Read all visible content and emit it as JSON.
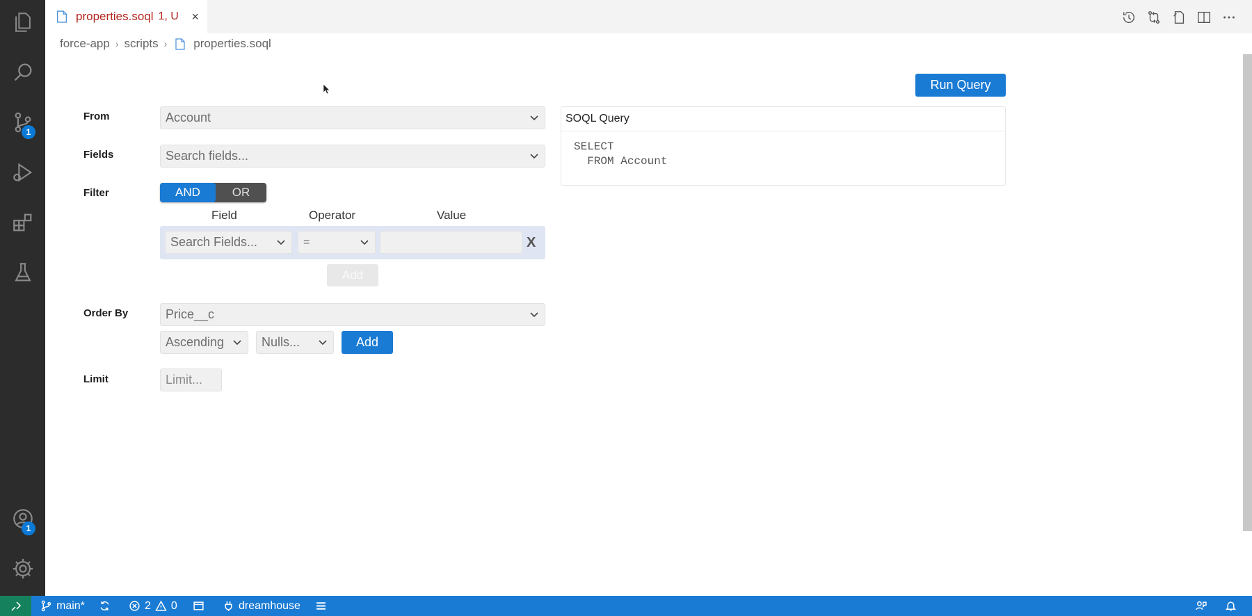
{
  "activity_bar": {
    "source_control_badge": "1",
    "accounts_badge": "1",
    "items": [
      "explorer-icon",
      "search-icon",
      "source-control-icon",
      "run-debug-icon",
      "extensions-icon",
      "testing-icon",
      "accounts-icon",
      "settings-gear-icon"
    ]
  },
  "tab": {
    "title": "properties.soql",
    "status": "1, U",
    "close": "×"
  },
  "editor_actions": [
    "history-icon",
    "compare-icon",
    "open-file-icon",
    "split-editor-icon",
    "more-actions-icon"
  ],
  "breadcrumb": {
    "items": [
      "force-app",
      "scripts",
      "properties.soql"
    ],
    "separator": "›"
  },
  "builder": {
    "run_query_label": "Run Query",
    "from": {
      "label": "From",
      "value": "Account"
    },
    "fields": {
      "label": "Fields",
      "placeholder": "Search fields..."
    },
    "filter": {
      "label": "Filter",
      "and_label": "AND",
      "or_label": "OR",
      "columns": {
        "field": "Field",
        "operator": "Operator",
        "value": "Value"
      },
      "row": {
        "field_placeholder": "Search Fields...",
        "operator": "=",
        "value": ""
      },
      "remove_label": "X",
      "add_label": "Add"
    },
    "order_by": {
      "label": "Order By",
      "field": "Price__c",
      "direction": "Ascending",
      "nulls": "Nulls...",
      "add_label": "Add"
    },
    "limit": {
      "label": "Limit",
      "placeholder": "Limit..."
    }
  },
  "soql_panel": {
    "title": "SOQL Query",
    "query": "SELECT\n  FROM Account"
  },
  "status_bar": {
    "branch": "main*",
    "errors": "2",
    "warnings": "0",
    "org": "dreamhouse"
  },
  "colors": {
    "accent": "#1a7bd4",
    "activity_bar": "#2c2c2c",
    "remote": "#16825d",
    "tab_modified": "#b3261e"
  }
}
